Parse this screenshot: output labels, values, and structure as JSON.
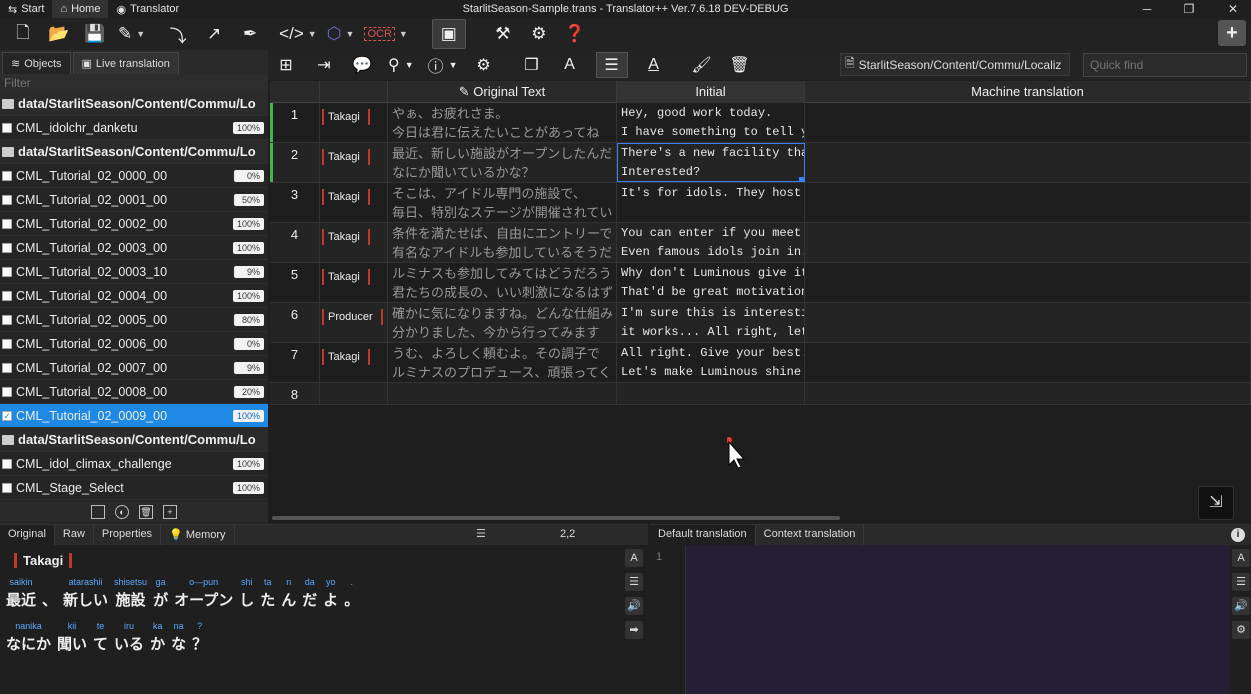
{
  "titlebar": {
    "menus": [
      {
        "label": "Start",
        "icon": "start-icon"
      },
      {
        "label": "Home",
        "icon": "home-icon"
      },
      {
        "label": "Translator",
        "icon": "chat-icon"
      }
    ],
    "window_title": "StarlitSeason-Sample.trans - Translator++ Ver.7.6.18 DEV-DEBUG"
  },
  "sidebar": {
    "tabs": [
      {
        "label": "Objects"
      },
      {
        "label": "Live translation"
      }
    ],
    "filter_placeholder": "Filter",
    "rows": [
      {
        "type": "folder",
        "label": "data/StarlitSeason/Content/Commu/Lo"
      },
      {
        "type": "file",
        "label": "CML_idolchr_danketu",
        "pct": "100%"
      },
      {
        "type": "folder",
        "label": "data/StarlitSeason/Content/Commu/Lo"
      },
      {
        "type": "file",
        "label": "CML_Tutorial_02_0000_00",
        "pct": "0%"
      },
      {
        "type": "file",
        "label": "CML_Tutorial_02_0001_00",
        "pct": "50%"
      },
      {
        "type": "file",
        "label": "CML_Tutorial_02_0002_00",
        "pct": "100%"
      },
      {
        "type": "file",
        "label": "CML_Tutorial_02_0003_00",
        "pct": "100%"
      },
      {
        "type": "file",
        "label": "CML_Tutorial_02_0003_10",
        "pct": "9%"
      },
      {
        "type": "file",
        "label": "CML_Tutorial_02_0004_00",
        "pct": "100%"
      },
      {
        "type": "file",
        "label": "CML_Tutorial_02_0005_00",
        "pct": "80%"
      },
      {
        "type": "file",
        "label": "CML_Tutorial_02_0006_00",
        "pct": "0%"
      },
      {
        "type": "file",
        "label": "CML_Tutorial_02_0007_00",
        "pct": "9%"
      },
      {
        "type": "file",
        "label": "CML_Tutorial_02_0008_00",
        "pct": "20%"
      },
      {
        "type": "file",
        "label": "CML_Tutorial_02_0009_00",
        "pct": "100%",
        "selected": true
      },
      {
        "type": "folder",
        "label": "data/StarlitSeason/Content/Commu/Lo"
      },
      {
        "type": "file",
        "label": "CML_idol_climax_challenge",
        "pct": "100%"
      },
      {
        "type": "file",
        "label": "CML_Stage_Select",
        "pct": "100%"
      }
    ]
  },
  "toolbar2": {
    "path": "StarlitSeason/Content/Commu/Localiz",
    "quickfind_placeholder": "Quick find"
  },
  "grid": {
    "headers": [
      "",
      "",
      "Original Text",
      "Initial",
      "Machine translation"
    ],
    "rows": [
      {
        "num": "1",
        "speaker": "Takagi",
        "orig1": "やぁ、お疲れさま。",
        "orig2": "今日は君に伝えたいことがあってね",
        "init1": "Hey, good work today.",
        "init2": "I have something to tell you"
      },
      {
        "num": "2",
        "speaker": "Takagi",
        "orig1": "最近、新しい施設がオープンしたんだ",
        "orig2": "なにか聞いているかな？",
        "init1": "There's a new facility that",
        "init2": "Interested?"
      },
      {
        "num": "3",
        "speaker": "Takagi",
        "orig1": "そこは、アイドル専門の施設で、",
        "orig2": "毎日、特別なステージが開催されてい",
        "init1": "It's for idols. They host sp",
        "init2": ""
      },
      {
        "num": "4",
        "speaker": "Takagi",
        "orig1": "条件を満たせば、自由にエントリーで",
        "orig2": "有名なアイドルも参加しているそうだ",
        "init1": "You can enter if you meet th",
        "init2": "Even famous idols join in."
      },
      {
        "num": "5",
        "speaker": "Takagi",
        "orig1": "ルミナスも参加してみてはどうだろう",
        "orig2": "君たちの成長の、いい刺激になるはず",
        "init1": "Why don't Luminous give it a",
        "init2": "That'd be great motivation"
      },
      {
        "num": "6",
        "speaker": "Producer",
        "orig1": "確かに気になりますね。どんな仕組み",
        "orig2": "分かりました、今から行ってみます",
        "init1": "I'm sure this is interesting",
        "init2": "it works... All right, let's"
      },
      {
        "num": "7",
        "speaker": "Takagi",
        "orig1": "うむ、よろしく頼むよ。その調子で",
        "orig2": "ルミナスのプロデュース、頑張ってく",
        "init1": "All right. Give your best.",
        "init2": "Let's make Luminous shine!"
      },
      {
        "num": "8",
        "speaker": "",
        "orig1": "",
        "orig2": "",
        "init1": "",
        "init2": ""
      }
    ]
  },
  "bottom_left": {
    "tabs": [
      "Original",
      "Raw",
      "Properties",
      "Memory"
    ],
    "coord": "2,2",
    "speaker": "Takagi",
    "line1": [
      {
        "r": "saikin",
        "b": "最近"
      },
      {
        "r": "",
        "b": "、"
      },
      {
        "r": "atarashii",
        "b": "新しい"
      },
      {
        "r": "shisetsu",
        "b": "施設"
      },
      {
        "r": "ga",
        "b": "が"
      },
      {
        "r": "o—pun",
        "b": "オープン"
      },
      {
        "r": "shi",
        "b": "し"
      },
      {
        "r": "ta",
        "b": "た"
      },
      {
        "r": "n",
        "b": "ん"
      },
      {
        "r": "da",
        "b": "だ"
      },
      {
        "r": "yo",
        "b": "よ"
      },
      {
        "r": ".",
        "b": "。"
      }
    ],
    "line2": [
      {
        "r": "nanika",
        "b": "なにか"
      },
      {
        "r": "kii",
        "b": "聞い"
      },
      {
        "r": "te",
        "b": "て"
      },
      {
        "r": "iru",
        "b": "いる"
      },
      {
        "r": "ka",
        "b": "か"
      },
      {
        "r": "na",
        "b": "な"
      },
      {
        "r": "?",
        "b": "？"
      }
    ]
  },
  "bottom_right": {
    "tabs": [
      "Default translation",
      "Context translation"
    ],
    "line_number": "1"
  }
}
